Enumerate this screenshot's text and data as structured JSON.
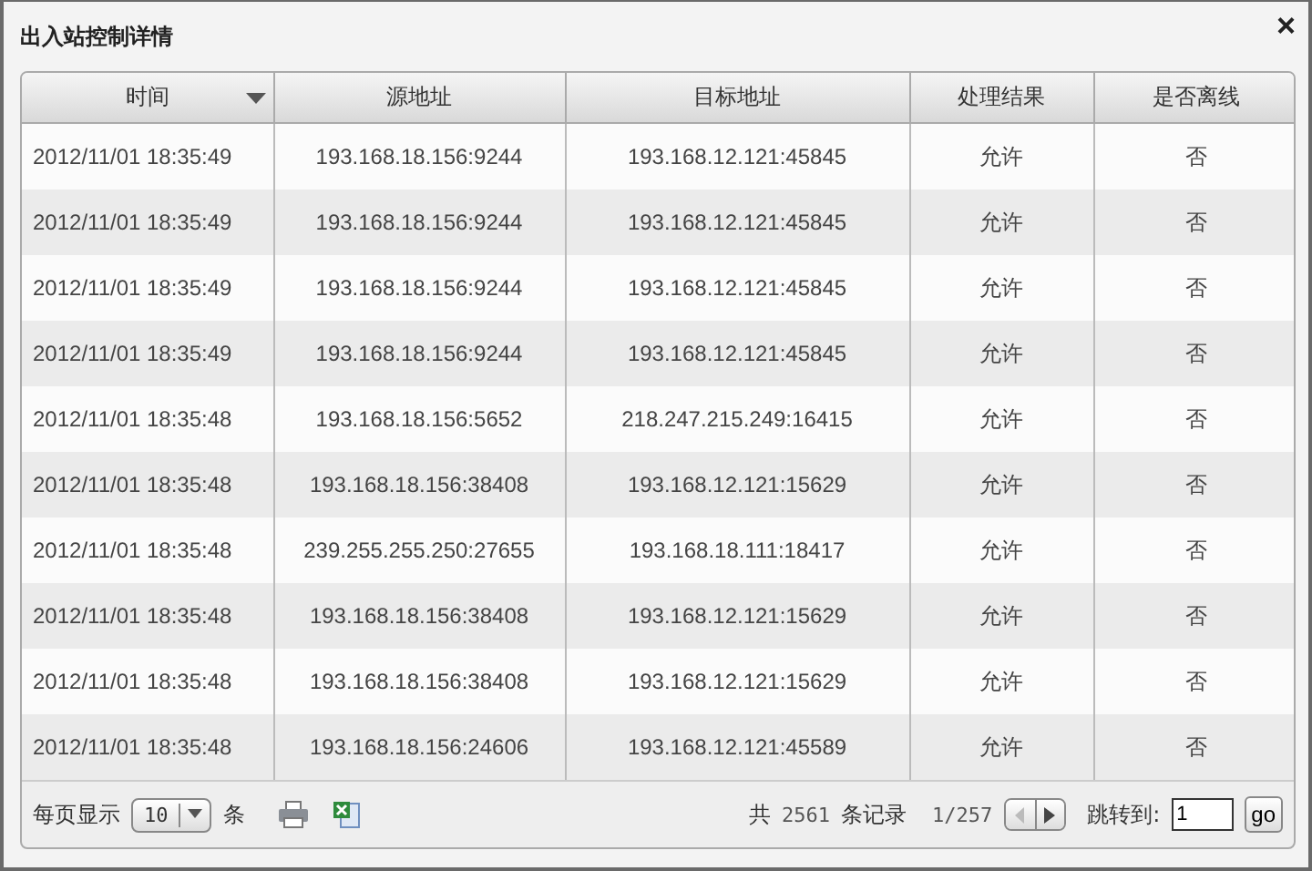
{
  "window": {
    "title": "出入站控制详情",
    "close": "×"
  },
  "table": {
    "columns": [
      {
        "label": "时间",
        "sorted": true
      },
      {
        "label": "源地址",
        "sorted": false
      },
      {
        "label": "目标地址",
        "sorted": false
      },
      {
        "label": "处理结果",
        "sorted": false
      },
      {
        "label": "是否离线",
        "sorted": false
      }
    ],
    "rows": [
      [
        "2012/11/01 18:35:49",
        "193.168.18.156:9244",
        "193.168.12.121:45845",
        "允许",
        "否"
      ],
      [
        "2012/11/01 18:35:49",
        "193.168.18.156:9244",
        "193.168.12.121:45845",
        "允许",
        "否"
      ],
      [
        "2012/11/01 18:35:49",
        "193.168.18.156:9244",
        "193.168.12.121:45845",
        "允许",
        "否"
      ],
      [
        "2012/11/01 18:35:49",
        "193.168.18.156:9244",
        "193.168.12.121:45845",
        "允许",
        "否"
      ],
      [
        "2012/11/01 18:35:48",
        "193.168.18.156:5652",
        "218.247.215.249:16415",
        "允许",
        "否"
      ],
      [
        "2012/11/01 18:35:48",
        "193.168.18.156:38408",
        "193.168.12.121:15629",
        "允许",
        "否"
      ],
      [
        "2012/11/01 18:35:48",
        "239.255.255.250:27655",
        "193.168.18.111:18417",
        "允许",
        "否"
      ],
      [
        "2012/11/01 18:35:48",
        "193.168.18.156:38408",
        "193.168.12.121:15629",
        "允许",
        "否"
      ],
      [
        "2012/11/01 18:35:48",
        "193.168.18.156:38408",
        "193.168.12.121:15629",
        "允许",
        "否"
      ],
      [
        "2012/11/01 18:35:48",
        "193.168.18.156:24606",
        "193.168.12.121:45589",
        "允许",
        "否"
      ]
    ]
  },
  "footer": {
    "page_size_label": "每页显示",
    "page_size": "10",
    "page_size_unit": "条",
    "total_prefix": "共",
    "total": "2561",
    "total_suffix": "条记录",
    "page": "1/257",
    "prev": {
      "disabled": true
    },
    "next": {
      "disabled": false
    },
    "jump_label": "跳转到:",
    "jump_value": "1",
    "go": "go"
  }
}
